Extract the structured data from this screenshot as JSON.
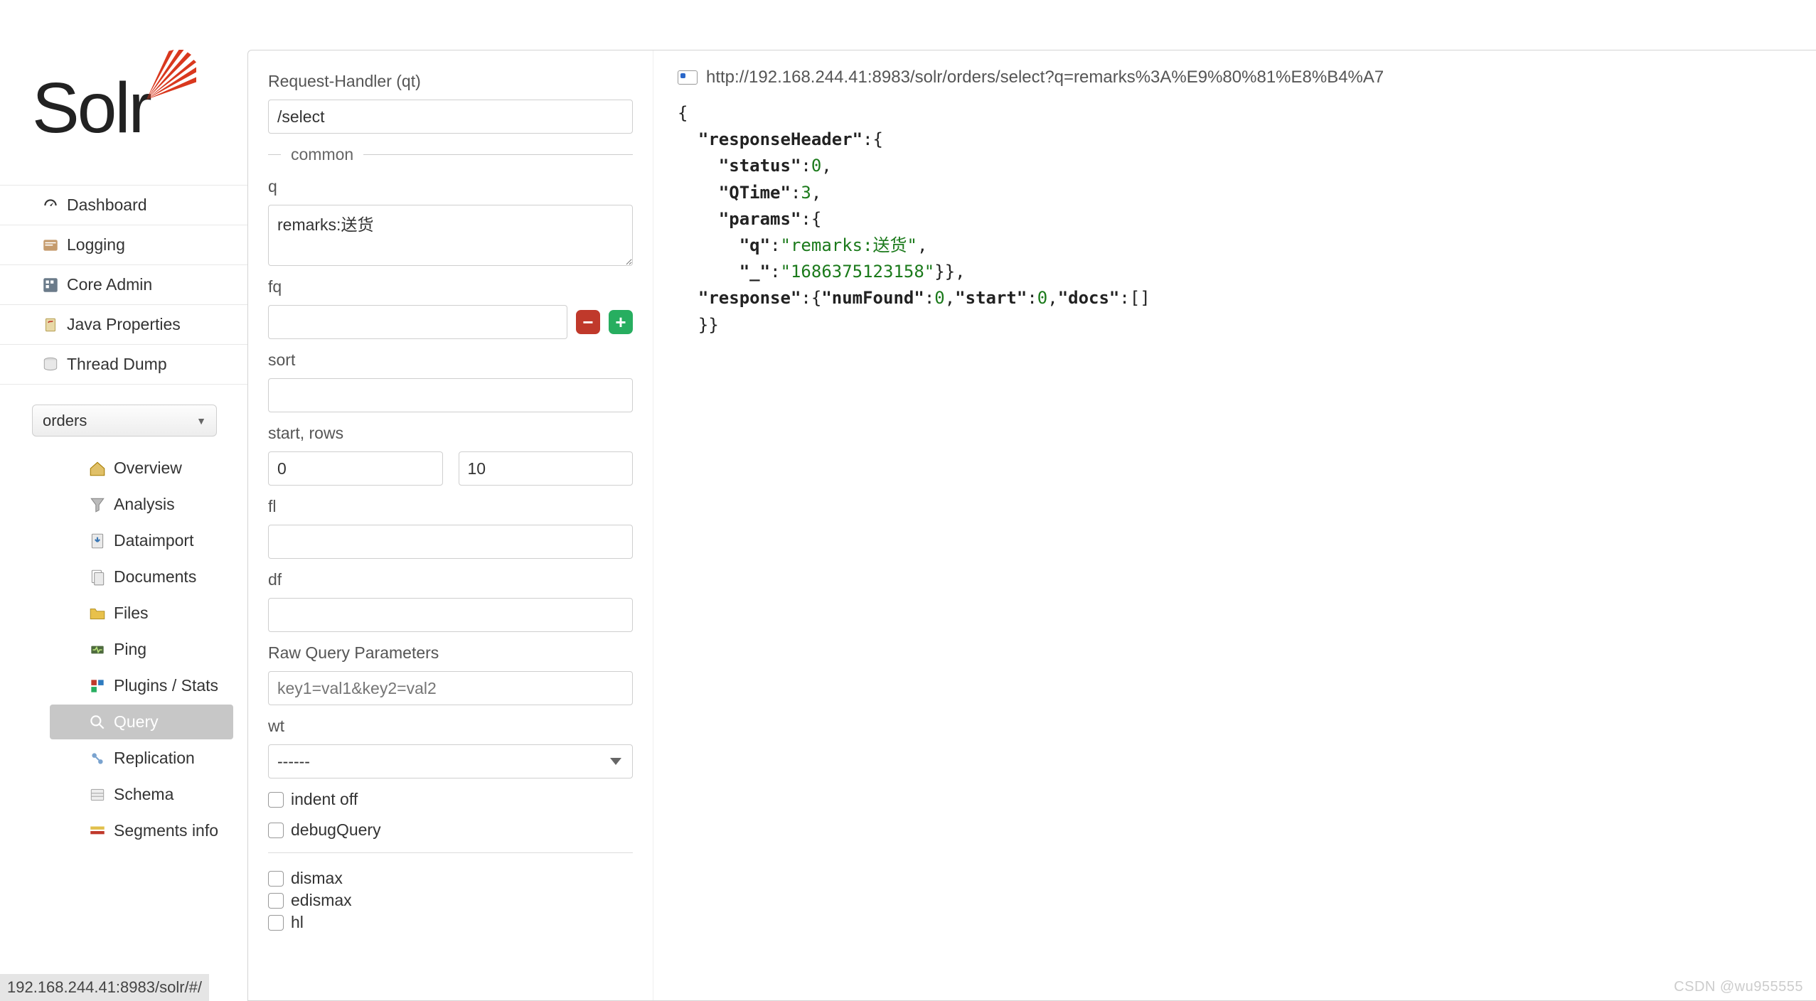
{
  "logo": {
    "text": "Solr"
  },
  "nav": {
    "items": [
      {
        "id": "dashboard",
        "label": "Dashboard"
      },
      {
        "id": "logging",
        "label": "Logging"
      },
      {
        "id": "core-admin",
        "label": "Core Admin"
      },
      {
        "id": "java-props",
        "label": "Java Properties"
      },
      {
        "id": "thread-dump",
        "label": "Thread Dump"
      }
    ]
  },
  "core_select": {
    "value": "orders"
  },
  "sub_nav": {
    "items": [
      {
        "id": "overview",
        "label": "Overview"
      },
      {
        "id": "analysis",
        "label": "Analysis"
      },
      {
        "id": "dataimport",
        "label": "Dataimport"
      },
      {
        "id": "documents",
        "label": "Documents"
      },
      {
        "id": "files",
        "label": "Files"
      },
      {
        "id": "ping",
        "label": "Ping"
      },
      {
        "id": "plugins-stats",
        "label": "Plugins / Stats"
      },
      {
        "id": "query",
        "label": "Query",
        "active": true
      },
      {
        "id": "replication",
        "label": "Replication"
      },
      {
        "id": "schema",
        "label": "Schema"
      },
      {
        "id": "segments-info",
        "label": "Segments info"
      }
    ]
  },
  "form": {
    "qt_label": "Request-Handler (qt)",
    "qt_value": "/select",
    "common_legend": "common",
    "q_label": "q",
    "q_value": "remarks:送货",
    "fq_label": "fq",
    "fq_value": "",
    "sort_label": "sort",
    "sort_value": "",
    "startrows_label": "start, rows",
    "start_value": "0",
    "rows_value": "10",
    "fl_label": "fl",
    "fl_value": "",
    "df_label": "df",
    "df_value": "",
    "raw_label": "Raw Query Parameters",
    "raw_placeholder": "key1=val1&key2=val2",
    "raw_value": "",
    "wt_label": "wt",
    "wt_value": "------",
    "check_indent": "indent off",
    "check_debug": "debugQuery",
    "check_dismax": "dismax",
    "check_edismax": "edismax",
    "check_hl": "hl"
  },
  "result": {
    "url": "http://192.168.244.41:8983/solr/orders/select?q=remarks%3A%E9%80%81%E8%B4%A7",
    "json": {
      "responseHeader": {
        "status": 0,
        "QTime": 3,
        "params": {
          "q": "remarks:送货",
          "_": "1686375123158"
        }
      },
      "response": {
        "numFound": 0,
        "start": 0,
        "docs": []
      }
    }
  },
  "status_url": "192.168.244.41:8983/solr/#/",
  "watermark": "CSDN @wu955555"
}
